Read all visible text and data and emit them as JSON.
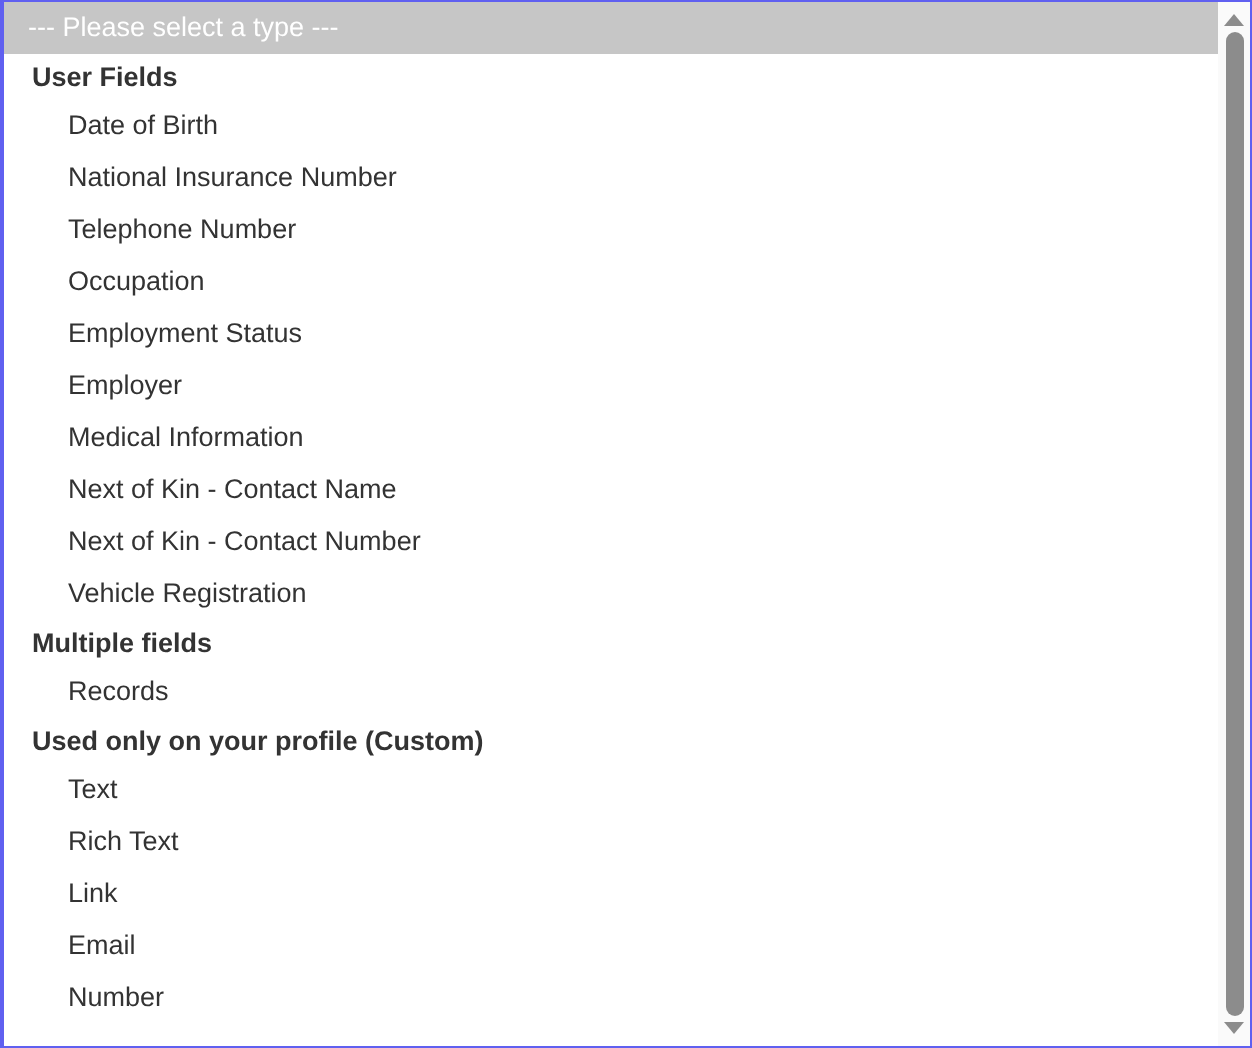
{
  "listbox": {
    "placeholder_option": {
      "label": "--- Please select a type ---",
      "selected": true
    },
    "groups": [
      {
        "heading": "User Fields",
        "options": [
          {
            "label": "Date of Birth",
            "selected": false
          },
          {
            "label": "National Insurance Number",
            "selected": false
          },
          {
            "label": "Telephone Number",
            "selected": false
          },
          {
            "label": "Occupation",
            "selected": false
          },
          {
            "label": "Employment Status",
            "selected": false
          },
          {
            "label": "Employer",
            "selected": false
          },
          {
            "label": "Medical Information",
            "selected": false
          },
          {
            "label": "Next of Kin - Contact Name",
            "selected": false
          },
          {
            "label": "Next of Kin - Contact Number",
            "selected": false
          },
          {
            "label": "Vehicle Registration",
            "selected": false
          }
        ]
      },
      {
        "heading": "Multiple fields",
        "options": [
          {
            "label": "Records",
            "selected": false
          }
        ]
      },
      {
        "heading": "Used only on your profile (Custom)",
        "options": [
          {
            "label": "Text",
            "selected": false
          },
          {
            "label": "Rich Text",
            "selected": false
          },
          {
            "label": "Link",
            "selected": false
          },
          {
            "label": "Email",
            "selected": false
          },
          {
            "label": "Number",
            "selected": false
          }
        ]
      }
    ]
  }
}
